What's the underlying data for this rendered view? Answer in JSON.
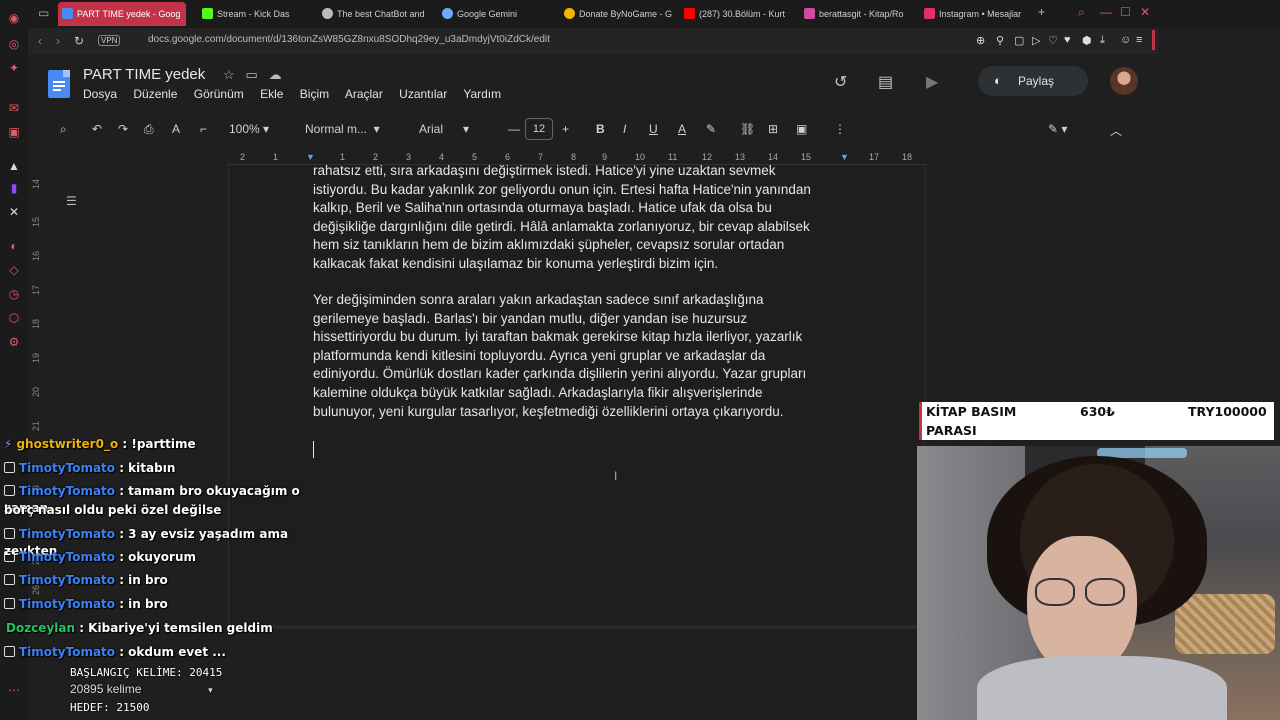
{
  "tabs": [
    {
      "label": "PART TIME yedek - Goog",
      "active": true,
      "icon_color": "#4a8af4"
    },
    {
      "label": "Stream - Kick Das",
      "active": false,
      "icon_color": "#53fc18"
    },
    {
      "label": "The best ChatBot and",
      "active": false,
      "icon_color": "#bbbbbb"
    },
    {
      "label": "Google Gemini",
      "active": false,
      "icon_color": "#6ea8ff"
    },
    {
      "label": "Donate ByNoGame - G",
      "active": false,
      "icon_color": "#f5b400"
    },
    {
      "label": "(287) 30.Bölüm - Kurt",
      "active": false,
      "icon_color": "#ff0000"
    },
    {
      "label": "berattasgit - Kitap/Ro",
      "active": false,
      "icon_color": "#d24aa0"
    },
    {
      "label": "Instagram • Mesajlar",
      "active": false,
      "icon_color": "#e1306c"
    }
  ],
  "address": {
    "vpn": "VPN",
    "url": "docs.google.com/document/d/136tonZsW85GZ8nxu8SODhq29ey_u3aDmdyjVt0iZdCk/edit"
  },
  "docs": {
    "title": "PART TIME  yedek",
    "menu": [
      "Dosya",
      "Düzenle",
      "Görünüm",
      "Ekle",
      "Biçim",
      "Araçlar",
      "Uzantılar",
      "Yardım"
    ],
    "share_label": "Paylaş",
    "toolbar": {
      "zoom": "100%",
      "style": "Normal m...",
      "font": "Arial",
      "font_size": "12"
    },
    "ruler": [
      "2",
      "1",
      "1",
      "2",
      "3",
      "4",
      "5",
      "6",
      "7",
      "8",
      "9",
      "10",
      "11",
      "12",
      "13",
      "14",
      "15",
      "16",
      "17",
      "18"
    ],
    "vruler": [
      "14",
      "15",
      "16",
      "17",
      "18",
      "19",
      "20",
      "21",
      "23",
      "25",
      "26"
    ],
    "para1": [
      "rahatsız etti, sıra arkadaşını değiştirmek istedi. Hatice'yi yine uzaktan sevmek",
      "istiyordu. Bu kadar yakınlık zor geliyordu onun için. Ertesi hafta Hatice'nin yanından",
      "kalkıp, Beril ve Saliha'nın ortasında oturmaya başladı. Hatice ufak da olsa bu",
      "değişikliğe dargınlığını dile getirdi. Hâlâ anlamakta zorlanıyoruz, bir cevap alabilsek",
      "hem siz tanıkların hem de bizim aklımızdaki şüpheler, cevapsız sorular ortadan",
      "kalkacak fakat kendisini ulaşılamaz bir konuma yerleştirdi bizim için."
    ],
    "para2": [
      "Yer değişiminden sonra araları yakın arkadaştan sadece sınıf arkadaşlığına",
      "gerilemeye başladı. Barlas'ı bir yandan mutlu, diğer yandan ise huzursuz",
      "hissettiriyordu bu durum. İyi taraftan bakmak gerekirse kitap hızla ilerliyor, yazarlık",
      "platformunda kendi kitlesini topluyordu. Ayrıca yeni gruplar ve arkadaşlar da",
      "ediniyordu. Ömürlük dostları kader çarkında dişlilerin yerini alıyordu. Yazar grupları",
      "kalemine oldukça büyük katkılar sağladı. Arkadaşlarıyla fikir alışverişlerinde",
      "bulunuyor, yeni kurgular tasarlıyor, keşfetmediği özelliklerini ortaya çıkarıyordu."
    ]
  },
  "chat": [
    {
      "user": "ghostwriter0_o",
      "text": " : !parttime",
      "color": "gold",
      "badge": "bolt"
    },
    {
      "user": "TimotyTomato",
      "text": " : kitabın",
      "color": "blue",
      "badge": "box"
    },
    {
      "user": "TimotyTomato",
      "text": " : tamam bro okuyacağım o zaman",
      "color": "blue",
      "badge": "box"
    },
    {
      "user": "",
      "text": "borç nasıl oldu peki özel değilse",
      "color": "white",
      "badge": "none"
    },
    {
      "user": "TimotyTomato",
      "text": " : 3 ay evsiz yaşadım ama zevkten",
      "color": "blue",
      "badge": "box"
    },
    {
      "user": "TimotyTomato",
      "text": " : okuyorum",
      "color": "blue",
      "badge": "box"
    },
    {
      "user": "TimotyTomato",
      "text": " : in bro",
      "color": "blue",
      "badge": "box"
    },
    {
      "user": "TimotyTomato",
      "text": " : in bro",
      "color": "blue",
      "badge": "box"
    },
    {
      "user": "Dozceylan",
      "text": " : Kibariye'yi temsilen geldim",
      "color": "green",
      "badge": "none"
    },
    {
      "user": "TimotyTomato",
      "text": " : okdum evet ...",
      "color": "blue",
      "badge": "box"
    }
  ],
  "counter": {
    "start": "BAŞLANGIÇ KELİME: 20415",
    "current": "20895 kelime",
    "target": "HEDEF: 21500"
  },
  "kitap": {
    "label1": "KİTAP BASIM",
    "label2": "PARASI",
    "amount": "630₺",
    "goal": "TRY100000"
  },
  "colors": {
    "accent": "#c2334a",
    "docs_blue": "#4a8af4",
    "chat_blue": "#3b82f6",
    "chat_green": "#22c55e",
    "chat_gold": "#eab308"
  }
}
